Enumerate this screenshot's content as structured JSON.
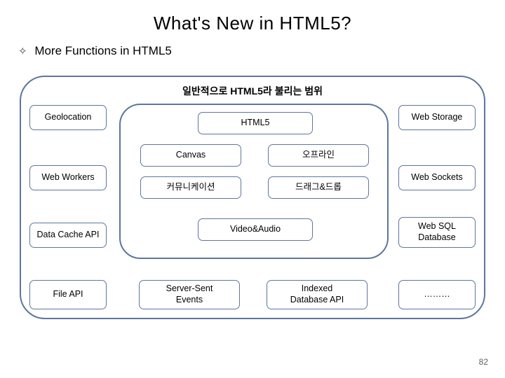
{
  "title": "What's New in HTML5?",
  "subhead": "More Functions in HTML5",
  "outer_label": "일반적으로 HTML5라 불리는 범위",
  "left": {
    "geolocation": "Geolocation",
    "web_workers": "Web Workers",
    "data_cache": "Data Cache API",
    "file_api": "File API"
  },
  "right": {
    "web_storage": "Web Storage",
    "web_sockets": "Web Sockets",
    "web_sql": "Web SQL\nDatabase",
    "dots": "………"
  },
  "inner": {
    "html5": "HTML5",
    "canvas": "Canvas",
    "offline": "오프라인",
    "communication": "커뮤니케이션",
    "dragdrop": "드래그&드롭",
    "videoaudio": "Video&Audio"
  },
  "bottom": {
    "sse": "Server-Sent\nEvents",
    "indexed": "Indexed\nDatabase API"
  },
  "page": "82"
}
